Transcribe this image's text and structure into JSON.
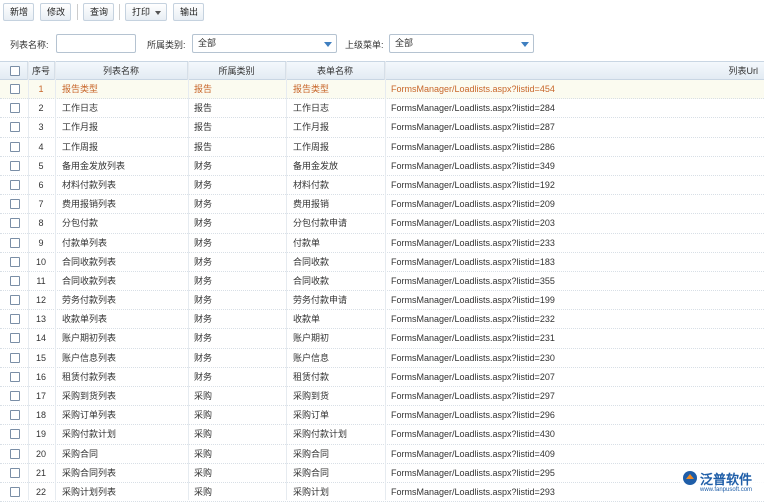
{
  "toolbar": {
    "add_label": "新增",
    "edit_label": "修改",
    "query_label": "查询",
    "print_label": "打印",
    "export_label": "输出"
  },
  "filters": {
    "list_name_label": "列表名称:",
    "list_name_value": "",
    "category_label": "所属类别:",
    "category_value": "全部",
    "parent_menu_label": "上级菜单:",
    "parent_menu_value": "全部"
  },
  "grid": {
    "headers": {
      "no": "序号",
      "name": "列表名称",
      "type": "所属类别",
      "form": "表单名称",
      "url": "列表Url"
    },
    "rows": [
      {
        "no": "1",
        "name": "报告类型",
        "type": "报告",
        "form": "报告类型",
        "url": "FormsManager/Loadlists.aspx?listid=454"
      },
      {
        "no": "2",
        "name": "工作日志",
        "type": "报告",
        "form": "工作日志",
        "url": "FormsManager/Loadlists.aspx?listid=284"
      },
      {
        "no": "3",
        "name": "工作月报",
        "type": "报告",
        "form": "工作月报",
        "url": "FormsManager/Loadlists.aspx?listid=287"
      },
      {
        "no": "4",
        "name": "工作周报",
        "type": "报告",
        "form": "工作周报",
        "url": "FormsManager/Loadlists.aspx?listid=286"
      },
      {
        "no": "5",
        "name": "备用金发放列表",
        "type": "财务",
        "form": "备用金发放",
        "url": "FormsManager/Loadlists.aspx?listid=349"
      },
      {
        "no": "6",
        "name": "材料付款列表",
        "type": "财务",
        "form": "材料付款",
        "url": "FormsManager/Loadlists.aspx?listid=192"
      },
      {
        "no": "7",
        "name": "费用报销列表",
        "type": "财务",
        "form": "费用报销",
        "url": "FormsManager/Loadlists.aspx?listid=209"
      },
      {
        "no": "8",
        "name": "分包付款",
        "type": "财务",
        "form": "分包付款申请",
        "url": "FormsManager/Loadlists.aspx?listid=203"
      },
      {
        "no": "9",
        "name": "付款单列表",
        "type": "财务",
        "form": "付款单",
        "url": "FormsManager/Loadlists.aspx?listid=233"
      },
      {
        "no": "10",
        "name": "合同收款列表",
        "type": "财务",
        "form": "合同收款",
        "url": "FormsManager/Loadlists.aspx?listid=183"
      },
      {
        "no": "11",
        "name": "合同收款列表",
        "type": "财务",
        "form": "合同收款",
        "url": "FormsManager/Loadlists.aspx?listid=355"
      },
      {
        "no": "12",
        "name": "劳务付款列表",
        "type": "财务",
        "form": "劳务付款申请",
        "url": "FormsManager/Loadlists.aspx?listid=199"
      },
      {
        "no": "13",
        "name": "收款单列表",
        "type": "财务",
        "form": "收款单",
        "url": "FormsManager/Loadlists.aspx?listid=232"
      },
      {
        "no": "14",
        "name": "账户期初列表",
        "type": "财务",
        "form": "账户期初",
        "url": "FormsManager/Loadlists.aspx?listid=231"
      },
      {
        "no": "15",
        "name": "账户信息列表",
        "type": "财务",
        "form": "账户信息",
        "url": "FormsManager/Loadlists.aspx?listid=230"
      },
      {
        "no": "16",
        "name": "租赁付款列表",
        "type": "财务",
        "form": "租赁付款",
        "url": "FormsManager/Loadlists.aspx?listid=207"
      },
      {
        "no": "17",
        "name": "采购到货列表",
        "type": "采购",
        "form": "采购到货",
        "url": "FormsManager/Loadlists.aspx?listid=297"
      },
      {
        "no": "18",
        "name": "采购订单列表",
        "type": "采购",
        "form": "采购订单",
        "url": "FormsManager/Loadlists.aspx?listid=296"
      },
      {
        "no": "19",
        "name": "采购付款计划",
        "type": "采购",
        "form": "采购付款计划",
        "url": "FormsManager/Loadlists.aspx?listid=430"
      },
      {
        "no": "20",
        "name": "采购合同",
        "type": "采购",
        "form": "采购合同",
        "url": "FormsManager/Loadlists.aspx?listid=409"
      },
      {
        "no": "21",
        "name": "采购合同列表",
        "type": "采购",
        "form": "采购合同",
        "url": "FormsManager/Loadlists.aspx?listid=295"
      },
      {
        "no": "22",
        "name": "采购计划列表",
        "type": "采购",
        "form": "采购计划",
        "url": "FormsManager/Loadlists.aspx?listid=293"
      }
    ]
  },
  "logo": {
    "text": "泛普软件",
    "sub": "www.fanpusoft.com"
  },
  "colors": {
    "selected_text": "#c8662a",
    "accent": "#3f7fc0"
  }
}
